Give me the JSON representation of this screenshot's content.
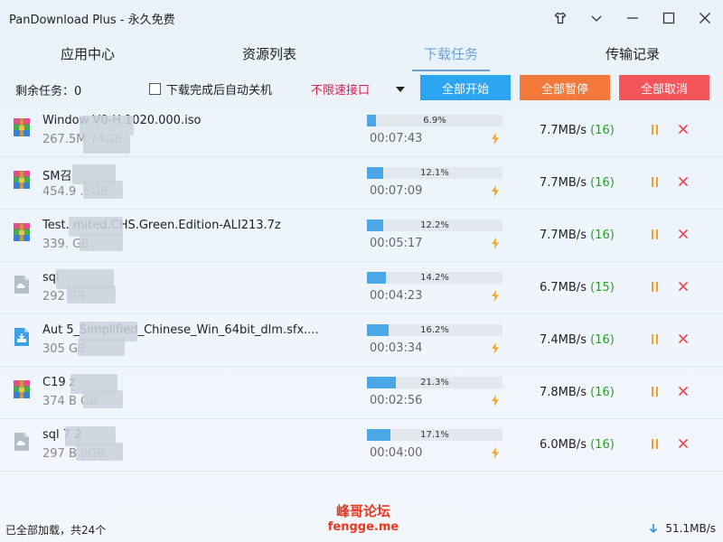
{
  "window": {
    "title": "PanDownload Plus - 永久免费"
  },
  "tabs": [
    {
      "label": "应用中心"
    },
    {
      "label": "资源列表"
    },
    {
      "label": "下载任务"
    },
    {
      "label": "传输记录"
    }
  ],
  "toolbar": {
    "remaining": "剩余任务：0",
    "auto_shutdown_label": "下载完成后自动关机",
    "speed_option": "不限速接口",
    "start_all": "全部开始",
    "pause_all": "全部暂停",
    "cancel_all": "全部取消"
  },
  "tasks": [
    {
      "name": "Window  V0-H.1020.000.iso",
      "size": "267.5M  74GB",
      "progress_pct": 6.9,
      "progress_label": "6.9%",
      "eta": "00:07:43",
      "speed": "7.7MB/s",
      "connections": "(16)",
      "icon": "winrar-archive-icon"
    },
    {
      "name": "SM召",
      "size": "454.9  .5GB",
      "progress_pct": 12.1,
      "progress_label": "12.1%",
      "eta": "00:07:09",
      "speed": "7.7MB/s",
      "connections": "(16)",
      "icon": "winrar-archive-icon"
    },
    {
      "name": "Test.  mited.CHS.Green.Edition-ALI213.7z",
      "size": "339.  GB",
      "progress_pct": 12.2,
      "progress_label": "12.2%",
      "eta": "00:05:17",
      "speed": "7.7MB/s",
      "connections": "(16)",
      "icon": "winrar-archive-icon"
    },
    {
      "name": "sql",
      "size": "292  GB",
      "progress_pct": 14.2,
      "progress_label": "14.2%",
      "eta": "00:04:23",
      "speed": "6.7MB/s",
      "connections": "(15)",
      "icon": "cloud-file-icon"
    },
    {
      "name": "Aut  5_Simplified_Chinese_Win_64bit_dlm.sfx....",
      "size": "305  GB",
      "progress_pct": 16.2,
      "progress_label": "16.2%",
      "eta": "00:03:34",
      "speed": "7.4MB/s",
      "connections": "(16)",
      "icon": "installer-file-icon"
    },
    {
      "name": "C19  z",
      "size": "374  B  GB",
      "progress_pct": 21.3,
      "progress_label": "21.3%",
      "eta": "00:02:56",
      "speed": "7.8MB/s",
      "connections": "(16)",
      "icon": "winrar-archive-icon"
    },
    {
      "name": "sql  7  2",
      "size": "297  B  9GB",
      "progress_pct": 17.1,
      "progress_label": "17.1%",
      "eta": "00:04:00",
      "speed": "6.0MB/s",
      "connections": "(16)",
      "icon": "cloud-file-icon"
    }
  ],
  "status": {
    "loaded": "已全部加载，共24个",
    "total_speed": "51.1MB/s"
  },
  "watermark": {
    "line1": "峰哥论坛",
    "line2": "fengge.me"
  },
  "colors": {
    "accent": "#6ea3d8",
    "start_button": "#2ca6f2",
    "pause_button": "#f47a3c",
    "cancel_button": "#f4555a",
    "progress": "#4aa7e8",
    "speed_option": "#d6204a",
    "connections": "#2a9a2a"
  }
}
